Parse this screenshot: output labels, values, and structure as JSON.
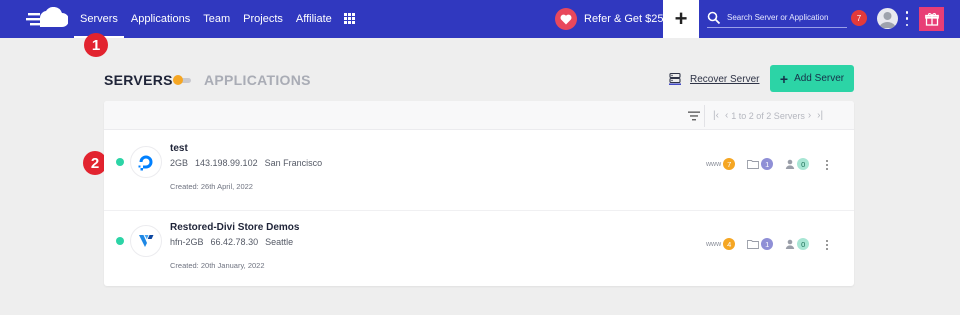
{
  "nav": {
    "items": [
      {
        "label": "Servers",
        "active": true
      },
      {
        "label": "Applications"
      },
      {
        "label": "Team"
      },
      {
        "label": "Projects"
      },
      {
        "label": "Affiliate"
      }
    ],
    "refer_label": "Refer & Get $25",
    "search_placeholder": "Search Server or Application",
    "notification_count": "7"
  },
  "markers": [
    "1",
    "2"
  ],
  "section": {
    "servers_label": "SERVERS",
    "applications_label": "APPLICATIONS",
    "recover_label": "Recover Server",
    "add_label": "Add Server"
  },
  "pager": {
    "text": "1 to 2 of 2 Servers"
  },
  "servers": [
    {
      "name": "test",
      "size": "2GB",
      "ip": "143.198.99.102",
      "location": "San Francisco",
      "created": "Created: 26th April, 2022",
      "www_label": "www",
      "apps": "7",
      "projects": "1",
      "members": "0",
      "provider": "digitalocean-icon"
    },
    {
      "name": "Restored-Divi Store Demos",
      "size": "hfn-2GB",
      "ip": "66.42.78.30",
      "location": "Seattle",
      "created": "Created: 20th January, 2022",
      "www_label": "www",
      "apps": "4",
      "projects": "1",
      "members": "0",
      "provider": "vultr-icon"
    }
  ],
  "colors": {
    "nav_bg": "#3038bf",
    "accent_green": "#2cd4a6",
    "marker_red": "#e2232f",
    "toggle_orange": "#f5a623"
  }
}
